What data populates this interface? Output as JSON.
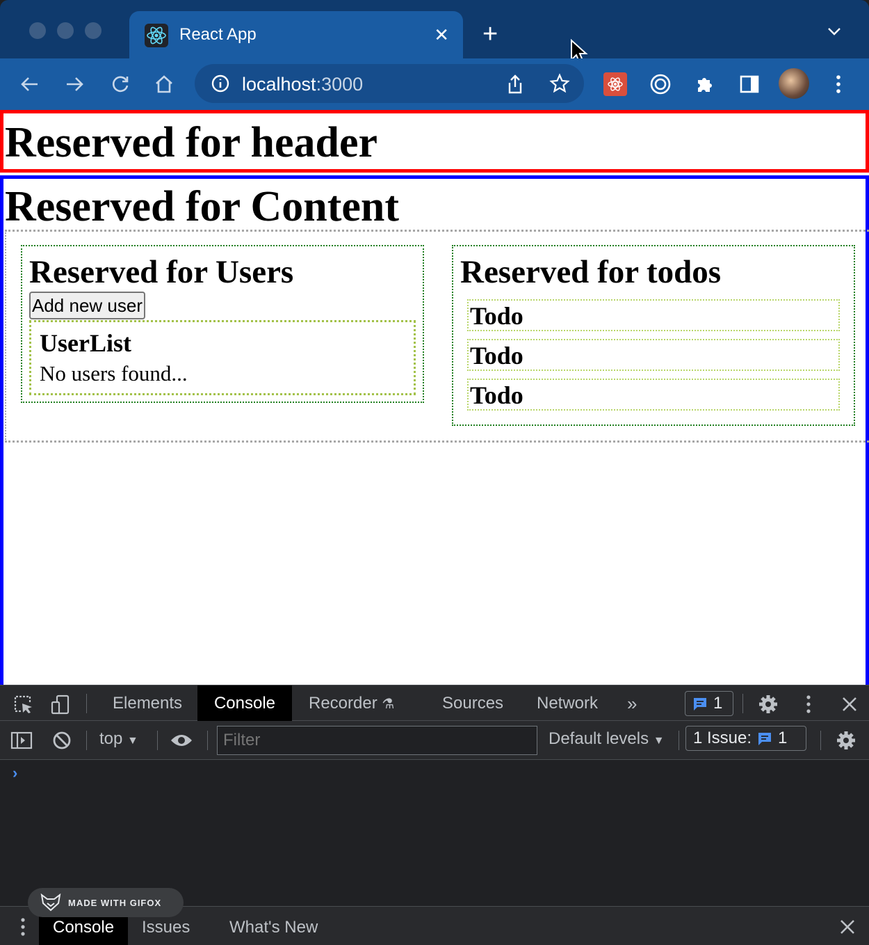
{
  "browser": {
    "tab_title": "React App",
    "url_host": "localhost",
    "url_port": ":3000"
  },
  "page": {
    "header_title": "Reserved for header",
    "content_title": "Reserved for Content",
    "users": {
      "title": "Reserved for Users",
      "add_button": "Add new user",
      "userlist_title": "UserList",
      "empty_message": "No users found..."
    },
    "todos": {
      "title": "Reserved for todos",
      "items": [
        "Todo",
        "Todo",
        "Todo"
      ]
    }
  },
  "devtools": {
    "tabs": [
      "Elements",
      "Console",
      "Recorder",
      "Sources",
      "Network"
    ],
    "active_tab": "Console",
    "messages_count": "1",
    "context": "top",
    "filter_placeholder": "Filter",
    "levels": "Default levels",
    "issues_label": "1 Issue:",
    "issues_count": "1",
    "drawer_tabs": [
      "Console",
      "Issues",
      "What's New"
    ]
  },
  "watermark": "MADE WITH GIFOX",
  "colors": {
    "header_border": "#ff0000",
    "content_border": "#0000ff",
    "panel_border": "#1f7f1f",
    "inner_border": "#a3c24a"
  }
}
